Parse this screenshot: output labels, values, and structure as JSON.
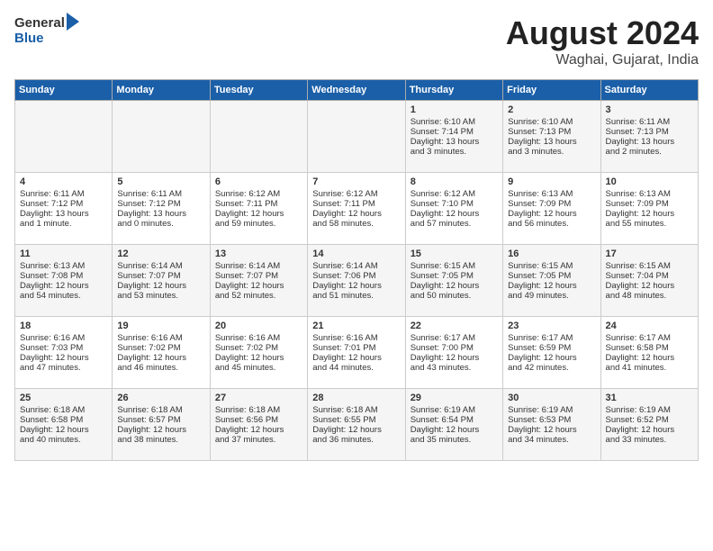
{
  "header": {
    "logo_general": "General",
    "logo_blue": "Blue",
    "month_title": "August 2024",
    "location": "Waghai, Gujarat, India"
  },
  "days_of_week": [
    "Sunday",
    "Monday",
    "Tuesday",
    "Wednesday",
    "Thursday",
    "Friday",
    "Saturday"
  ],
  "weeks": [
    [
      {
        "day": "",
        "info": ""
      },
      {
        "day": "",
        "info": ""
      },
      {
        "day": "",
        "info": ""
      },
      {
        "day": "",
        "info": ""
      },
      {
        "day": "1",
        "info": "Sunrise: 6:10 AM\nSunset: 7:14 PM\nDaylight: 13 hours\nand 3 minutes."
      },
      {
        "day": "2",
        "info": "Sunrise: 6:10 AM\nSunset: 7:13 PM\nDaylight: 13 hours\nand 3 minutes."
      },
      {
        "day": "3",
        "info": "Sunrise: 6:11 AM\nSunset: 7:13 PM\nDaylight: 13 hours\nand 2 minutes."
      }
    ],
    [
      {
        "day": "4",
        "info": "Sunrise: 6:11 AM\nSunset: 7:12 PM\nDaylight: 13 hours\nand 1 minute."
      },
      {
        "day": "5",
        "info": "Sunrise: 6:11 AM\nSunset: 7:12 PM\nDaylight: 13 hours\nand 0 minutes."
      },
      {
        "day": "6",
        "info": "Sunrise: 6:12 AM\nSunset: 7:11 PM\nDaylight: 12 hours\nand 59 minutes."
      },
      {
        "day": "7",
        "info": "Sunrise: 6:12 AM\nSunset: 7:11 PM\nDaylight: 12 hours\nand 58 minutes."
      },
      {
        "day": "8",
        "info": "Sunrise: 6:12 AM\nSunset: 7:10 PM\nDaylight: 12 hours\nand 57 minutes."
      },
      {
        "day": "9",
        "info": "Sunrise: 6:13 AM\nSunset: 7:09 PM\nDaylight: 12 hours\nand 56 minutes."
      },
      {
        "day": "10",
        "info": "Sunrise: 6:13 AM\nSunset: 7:09 PM\nDaylight: 12 hours\nand 55 minutes."
      }
    ],
    [
      {
        "day": "11",
        "info": "Sunrise: 6:13 AM\nSunset: 7:08 PM\nDaylight: 12 hours\nand 54 minutes."
      },
      {
        "day": "12",
        "info": "Sunrise: 6:14 AM\nSunset: 7:07 PM\nDaylight: 12 hours\nand 53 minutes."
      },
      {
        "day": "13",
        "info": "Sunrise: 6:14 AM\nSunset: 7:07 PM\nDaylight: 12 hours\nand 52 minutes."
      },
      {
        "day": "14",
        "info": "Sunrise: 6:14 AM\nSunset: 7:06 PM\nDaylight: 12 hours\nand 51 minutes."
      },
      {
        "day": "15",
        "info": "Sunrise: 6:15 AM\nSunset: 7:05 PM\nDaylight: 12 hours\nand 50 minutes."
      },
      {
        "day": "16",
        "info": "Sunrise: 6:15 AM\nSunset: 7:05 PM\nDaylight: 12 hours\nand 49 minutes."
      },
      {
        "day": "17",
        "info": "Sunrise: 6:15 AM\nSunset: 7:04 PM\nDaylight: 12 hours\nand 48 minutes."
      }
    ],
    [
      {
        "day": "18",
        "info": "Sunrise: 6:16 AM\nSunset: 7:03 PM\nDaylight: 12 hours\nand 47 minutes."
      },
      {
        "day": "19",
        "info": "Sunrise: 6:16 AM\nSunset: 7:02 PM\nDaylight: 12 hours\nand 46 minutes."
      },
      {
        "day": "20",
        "info": "Sunrise: 6:16 AM\nSunset: 7:02 PM\nDaylight: 12 hours\nand 45 minutes."
      },
      {
        "day": "21",
        "info": "Sunrise: 6:16 AM\nSunset: 7:01 PM\nDaylight: 12 hours\nand 44 minutes."
      },
      {
        "day": "22",
        "info": "Sunrise: 6:17 AM\nSunset: 7:00 PM\nDaylight: 12 hours\nand 43 minutes."
      },
      {
        "day": "23",
        "info": "Sunrise: 6:17 AM\nSunset: 6:59 PM\nDaylight: 12 hours\nand 42 minutes."
      },
      {
        "day": "24",
        "info": "Sunrise: 6:17 AM\nSunset: 6:58 PM\nDaylight: 12 hours\nand 41 minutes."
      }
    ],
    [
      {
        "day": "25",
        "info": "Sunrise: 6:18 AM\nSunset: 6:58 PM\nDaylight: 12 hours\nand 40 minutes."
      },
      {
        "day": "26",
        "info": "Sunrise: 6:18 AM\nSunset: 6:57 PM\nDaylight: 12 hours\nand 38 minutes."
      },
      {
        "day": "27",
        "info": "Sunrise: 6:18 AM\nSunset: 6:56 PM\nDaylight: 12 hours\nand 37 minutes."
      },
      {
        "day": "28",
        "info": "Sunrise: 6:18 AM\nSunset: 6:55 PM\nDaylight: 12 hours\nand 36 minutes."
      },
      {
        "day": "29",
        "info": "Sunrise: 6:19 AM\nSunset: 6:54 PM\nDaylight: 12 hours\nand 35 minutes."
      },
      {
        "day": "30",
        "info": "Sunrise: 6:19 AM\nSunset: 6:53 PM\nDaylight: 12 hours\nand 34 minutes."
      },
      {
        "day": "31",
        "info": "Sunrise: 6:19 AM\nSunset: 6:52 PM\nDaylight: 12 hours\nand 33 minutes."
      }
    ]
  ]
}
